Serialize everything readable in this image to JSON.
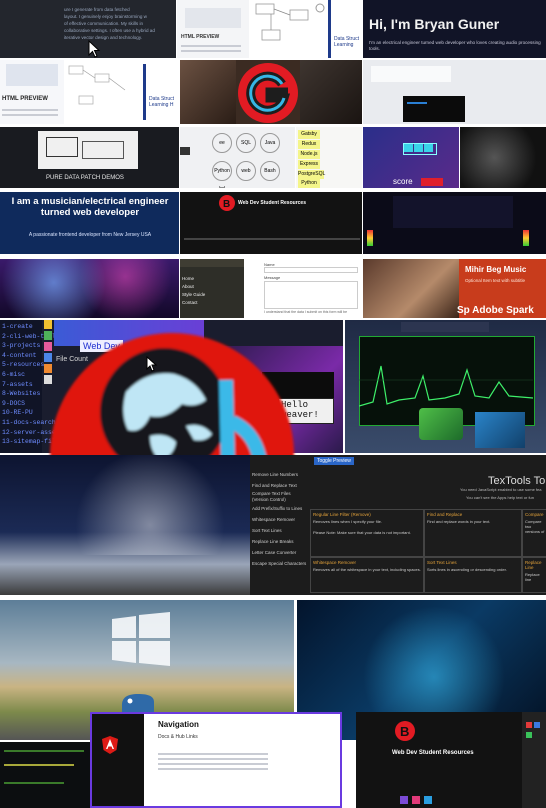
{
  "gallery": {
    "description_lines": [
      "ure I generate from data fetched",
      "layout. I genuinely enjoy brainstorming w",
      "of effective communication. My skills in",
      "collaborative settings. I often use a hybrid ad",
      "iterative vector design and technology."
    ],
    "html_preview_small": "HTML PREVIEW",
    "data_structures_label": "Data Struct Learning",
    "bryan": {
      "title": "Hi, I'm Bryan Guner",
      "subtitle": "I'm an electrical engineer turned web developer who loves creating audio processing tools."
    },
    "html_preview": "HTML PREVIEW",
    "data_structures_label2": "Data Struct Learning H",
    "pure_data_caption": "PURE DATA PATCH DEMOS",
    "tags": [
      "Gatsby",
      "Redux",
      "Node.js",
      "Express",
      "PostgreSQL",
      "Python"
    ],
    "circles": [
      "ee",
      "SQL",
      "Java",
      "Python hd",
      "web",
      "Bash"
    ],
    "score_label": "score",
    "musician": {
      "title": "I am a musician/electrical engineer turned web developer",
      "subtitle": "A passionate frontend developer from New Jersey USA"
    },
    "web_dev_resources": "Web Dev Student Resources",
    "form_labels": [
      "Name",
      "Message"
    ],
    "form_note": "I understand that the data I submit on this form will be",
    "menu_links": [
      "Home",
      "About",
      "Style Guide",
      "Contact"
    ],
    "mihir": {
      "title": "Mihir Beg Music",
      "subtitle": "Optional Item text with subtitle",
      "adobe": "Sp Adobe Spark"
    },
    "terminal": {
      "items": [
        "1-create",
        "2-cli-web-tools",
        "3-projects",
        "4-content",
        "5-resources",
        "6-misc",
        "7-assets",
        "8-Websites",
        "9-DOCS",
        "10-RE-PU",
        "11-docs-search",
        "12-server-assets",
        "13-sitemap-file"
      ],
      "web_dev": "Web Dev",
      "file_count": "File Count"
    },
    "hello_weaver": "Hello weaver!",
    "texttools": {
      "tab": "Toggle Preview",
      "title": "TexTools To",
      "notice": "You need JavaScript enabled to use some fea",
      "notice2": "You can't see the Apps help text or fun",
      "menu": [
        "Remove Line Numbers",
        "Find and Replace Text",
        "Compare Text Files (Version Control)",
        "Add Prefix/Suffix to Lines",
        "Whitespace Remover",
        "Sort Text Lines",
        "Replace Line Breaks",
        "Letter Case Converter",
        "Escape Special Characters"
      ],
      "boxes": [
        {
          "title": "Regular Line Filter (Remove)",
          "body": "Removes lines when I specify your file."
        },
        {
          "title": "Find and Replace",
          "body": "Find and replace words in your text."
        },
        {
          "title": "Compare",
          "body": "Compare two versions of"
        },
        {
          "title": "Whitespace Remover",
          "body": "Removes all of the whitespace in your text, including spaces."
        },
        {
          "title": "Sort Text Lines",
          "body": "Sorts lines in ascending or descending order."
        },
        {
          "title": "Replace Line",
          "body": "Replace line"
        }
      ],
      "note": "Please Note: Make sure that your data is not important."
    },
    "navigation": {
      "title": "Navigation",
      "subtitle": "Docs & Hub Links"
    },
    "web_dev_resources2": "Web Dev Student Resources"
  }
}
